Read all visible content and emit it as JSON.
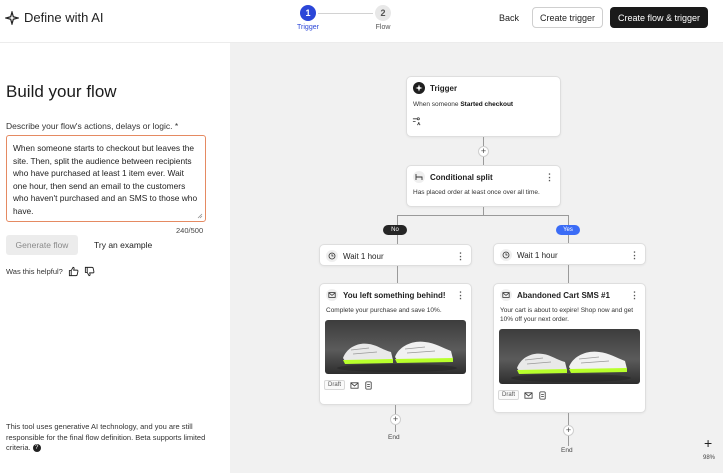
{
  "header": {
    "brand_icon": "sparkle-icon",
    "brand_title": "Define with AI",
    "steps": [
      {
        "number": "1",
        "label": "Trigger"
      },
      {
        "number": "2",
        "label": "Flow"
      }
    ],
    "back_label": "Back",
    "create_trigger_label": "Create trigger",
    "create_flow_label": "Create flow & trigger"
  },
  "left": {
    "title": "Build your flow",
    "prompt_label": "Describe your flow's actions, delays or logic. *",
    "prompt_value": "When someone starts to checkout but leaves the site. Then, split the audience between recipients who have purchased at least 1 item ever. Wait one hour, then send an email to the customers who haven't purchased and an SMS to those who have.",
    "char_count": "240/500",
    "generate_label": "Generate flow",
    "example_label": "Try an example",
    "helpful_label": "Was this helpful?",
    "disclaimer": "This tool uses generative AI technology, and you are still responsible for the final flow definition. Beta supports limited criteria."
  },
  "canvas": {
    "trigger": {
      "title": "Trigger",
      "desc_prefix": "When someone ",
      "desc_bold": "Started checkout"
    },
    "split": {
      "title": "Conditional split",
      "desc": "Has placed order at least once over all time."
    },
    "branch_no": "No",
    "branch_yes": "Yes",
    "left_wait": "Wait 1 hour",
    "right_wait": "Wait 1 hour",
    "email": {
      "title": "You left something behind!",
      "desc": "Complete your purchase and save 10%.",
      "status": "Draft"
    },
    "sms": {
      "title": "Abandoned Cart SMS #1",
      "desc": "Your cart is about to expire! Shop now and get 10% off your next order.",
      "status": "Draft"
    },
    "end_label_left": "End",
    "end_label_right": "End",
    "zoom_level": "98%"
  },
  "colors": {
    "primary": "#2b46d8",
    "yes_pill": "#3b6cf6",
    "no_pill": "#262626",
    "prompt_border": "#e58a62"
  }
}
